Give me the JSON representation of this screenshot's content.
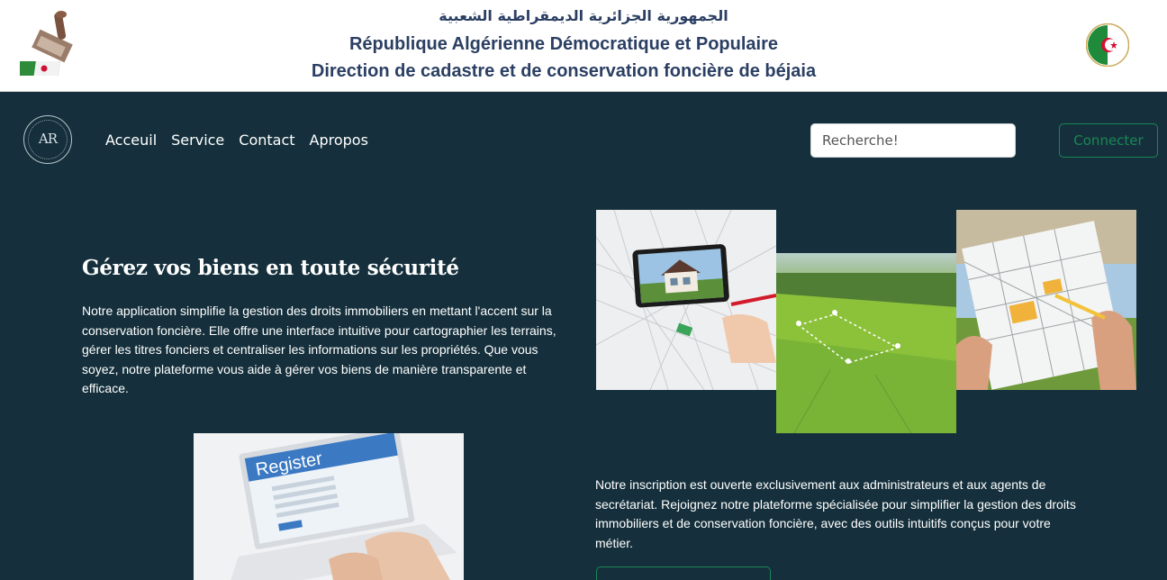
{
  "header": {
    "arabic_title": "الجمهورية الجزائرية الديمقراطية الشعبية",
    "republic_name": "République Algérienne Démocratique et Populaire",
    "direction_name": "Direction de cadastre et de conservation foncière de béjaia"
  },
  "brand": {
    "monogram": "AR"
  },
  "nav": {
    "links": [
      "Acceuil",
      "Service",
      "Contact",
      "Apropos"
    ],
    "search_placeholder": "Recherche!",
    "connect_label": "Connecter"
  },
  "hero": {
    "title": "Gérez vos biens en toute sécurité",
    "description": "Notre application simplifie la gestion des droits immobiliers en mettant l'accent sur la conservation foncière. Elle offre une interface intuitive pour cartographier les terrains, gérer les titres fonciers et centraliser les informations sur les propriétés. Que vous soyez, notre plateforme vous aide à gérer vos biens de manière transparente et efficace."
  },
  "signup": {
    "text": "Notre inscription est ouverte exclusivement aux administrateurs et aux agents de secrétariat. Rejoignez notre plateforme spécialisée pour simplifier la gestion des droits immobiliers et de conservation foncière, avec des outils intuitifs conçus pour votre métier."
  },
  "images": {
    "register_word": "Register"
  },
  "colors": {
    "background": "#15303c",
    "header_text": "#2b3f63",
    "accent_green": "#198754"
  }
}
